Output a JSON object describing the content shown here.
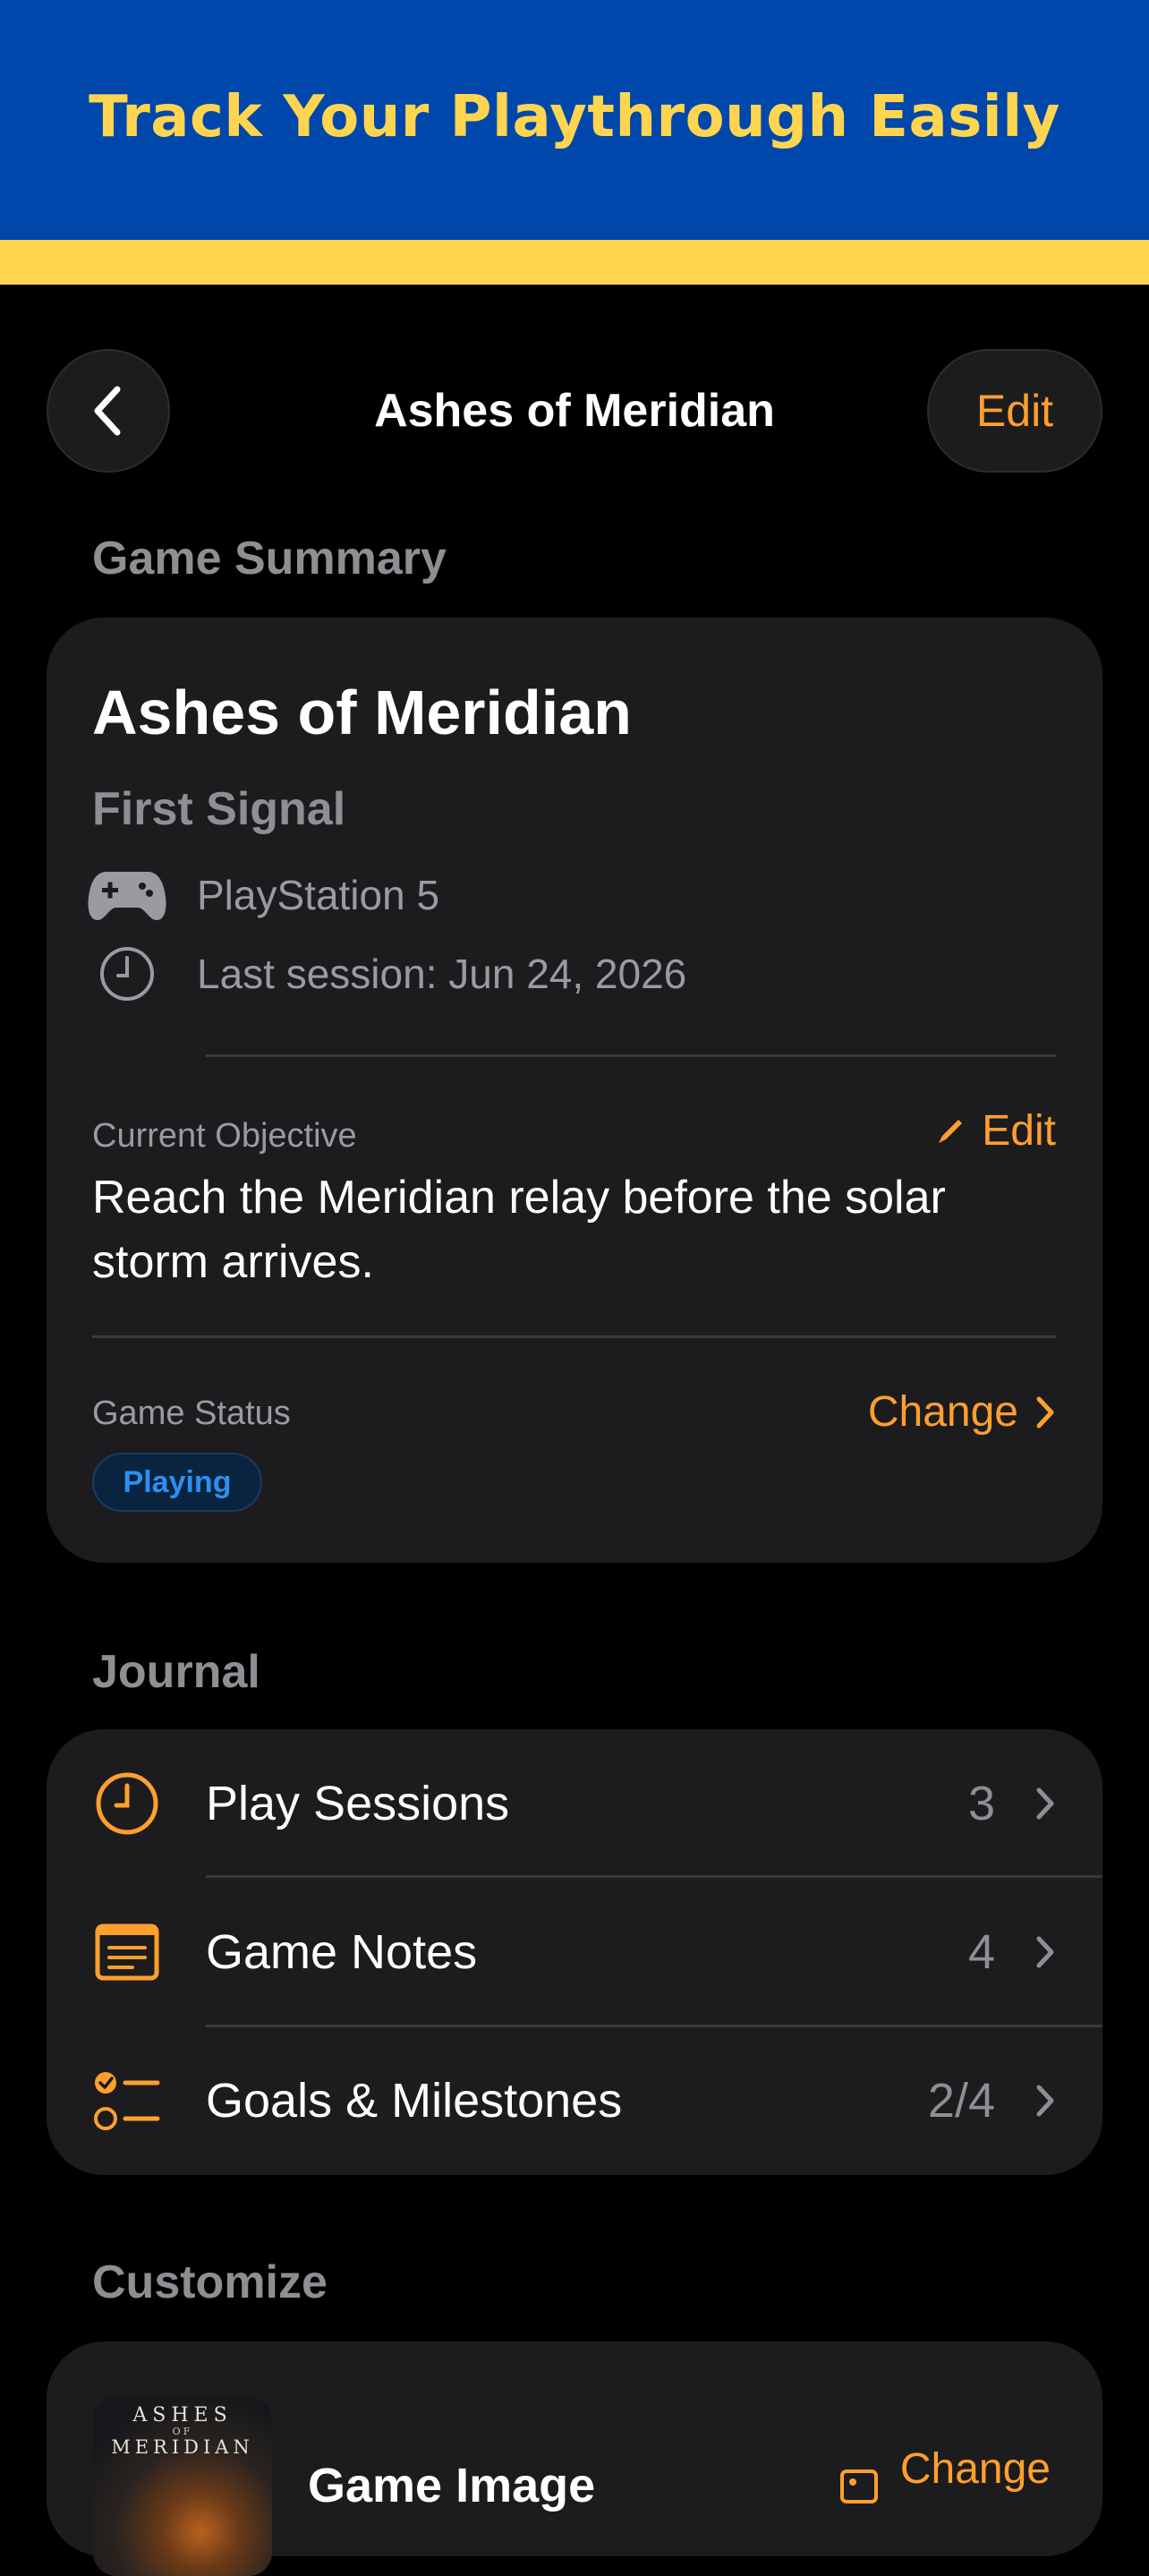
{
  "promo": {
    "headline": "Track Your Playthrough Easily"
  },
  "nav": {
    "title": "Ashes of Meridian",
    "edit_label": "Edit"
  },
  "summary": {
    "section_title": "Game Summary",
    "game_title": "Ashes of Meridian",
    "subtitle": "First Signal",
    "platform": "PlayStation 5",
    "last_session": "Last session: Jun 24, 2026",
    "objective_label": "Current Objective",
    "objective_edit_label": "Edit",
    "objective_text": "Reach the Meridian relay before the solar storm arrives.",
    "status_label": "Game Status",
    "status_change_label": "Change",
    "status_badge": "Playing"
  },
  "journal": {
    "section_title": "Journal",
    "items": [
      {
        "label": "Play Sessions",
        "count": "3",
        "icon": "clock-icon"
      },
      {
        "label": "Game Notes",
        "count": "4",
        "icon": "notes-icon"
      },
      {
        "label": "Goals & Milestones",
        "count": "2/4",
        "icon": "checklist-icon"
      }
    ]
  },
  "customize": {
    "section_title": "Customize",
    "image_label": "Game Image",
    "change_label": "Change",
    "cover_line1": "ASHES",
    "cover_line2": "OF",
    "cover_line3": "MERIDIAN"
  },
  "colors": {
    "accent": "#FF9F2E",
    "promo_bg": "#0047AB",
    "promo_text": "#FFD54F",
    "badge_text": "#2E8EF0",
    "card_bg": "#1C1C1E"
  }
}
